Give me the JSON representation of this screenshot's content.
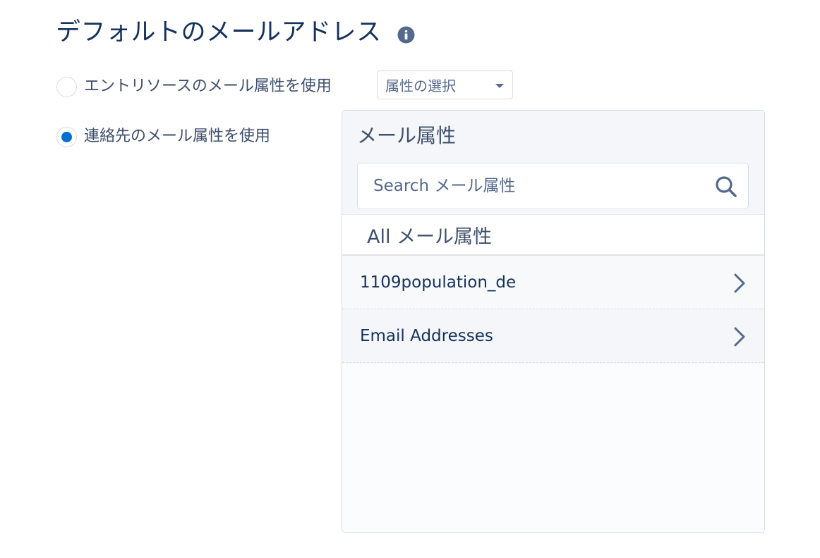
{
  "header": {
    "title": "デフォルトのメールアドレス",
    "info_icon": "info-icon"
  },
  "options": [
    {
      "label": "エントリソースのメール属性を使用",
      "selected": false
    },
    {
      "label": "連絡先のメール属性を使用",
      "selected": true
    }
  ],
  "attribute_select": {
    "value": "属性の選択"
  },
  "panel": {
    "title": "メール属性",
    "search_placeholder": "Search メール属性",
    "all_label": "All メール属性",
    "items": [
      {
        "label": "1109population_de"
      },
      {
        "label": "Email Addresses"
      }
    ]
  },
  "colors": {
    "primary_text": "#16325c",
    "secondary_text": "#3e4e6c",
    "accent": "#0070d2",
    "border": "#d8dde6"
  }
}
